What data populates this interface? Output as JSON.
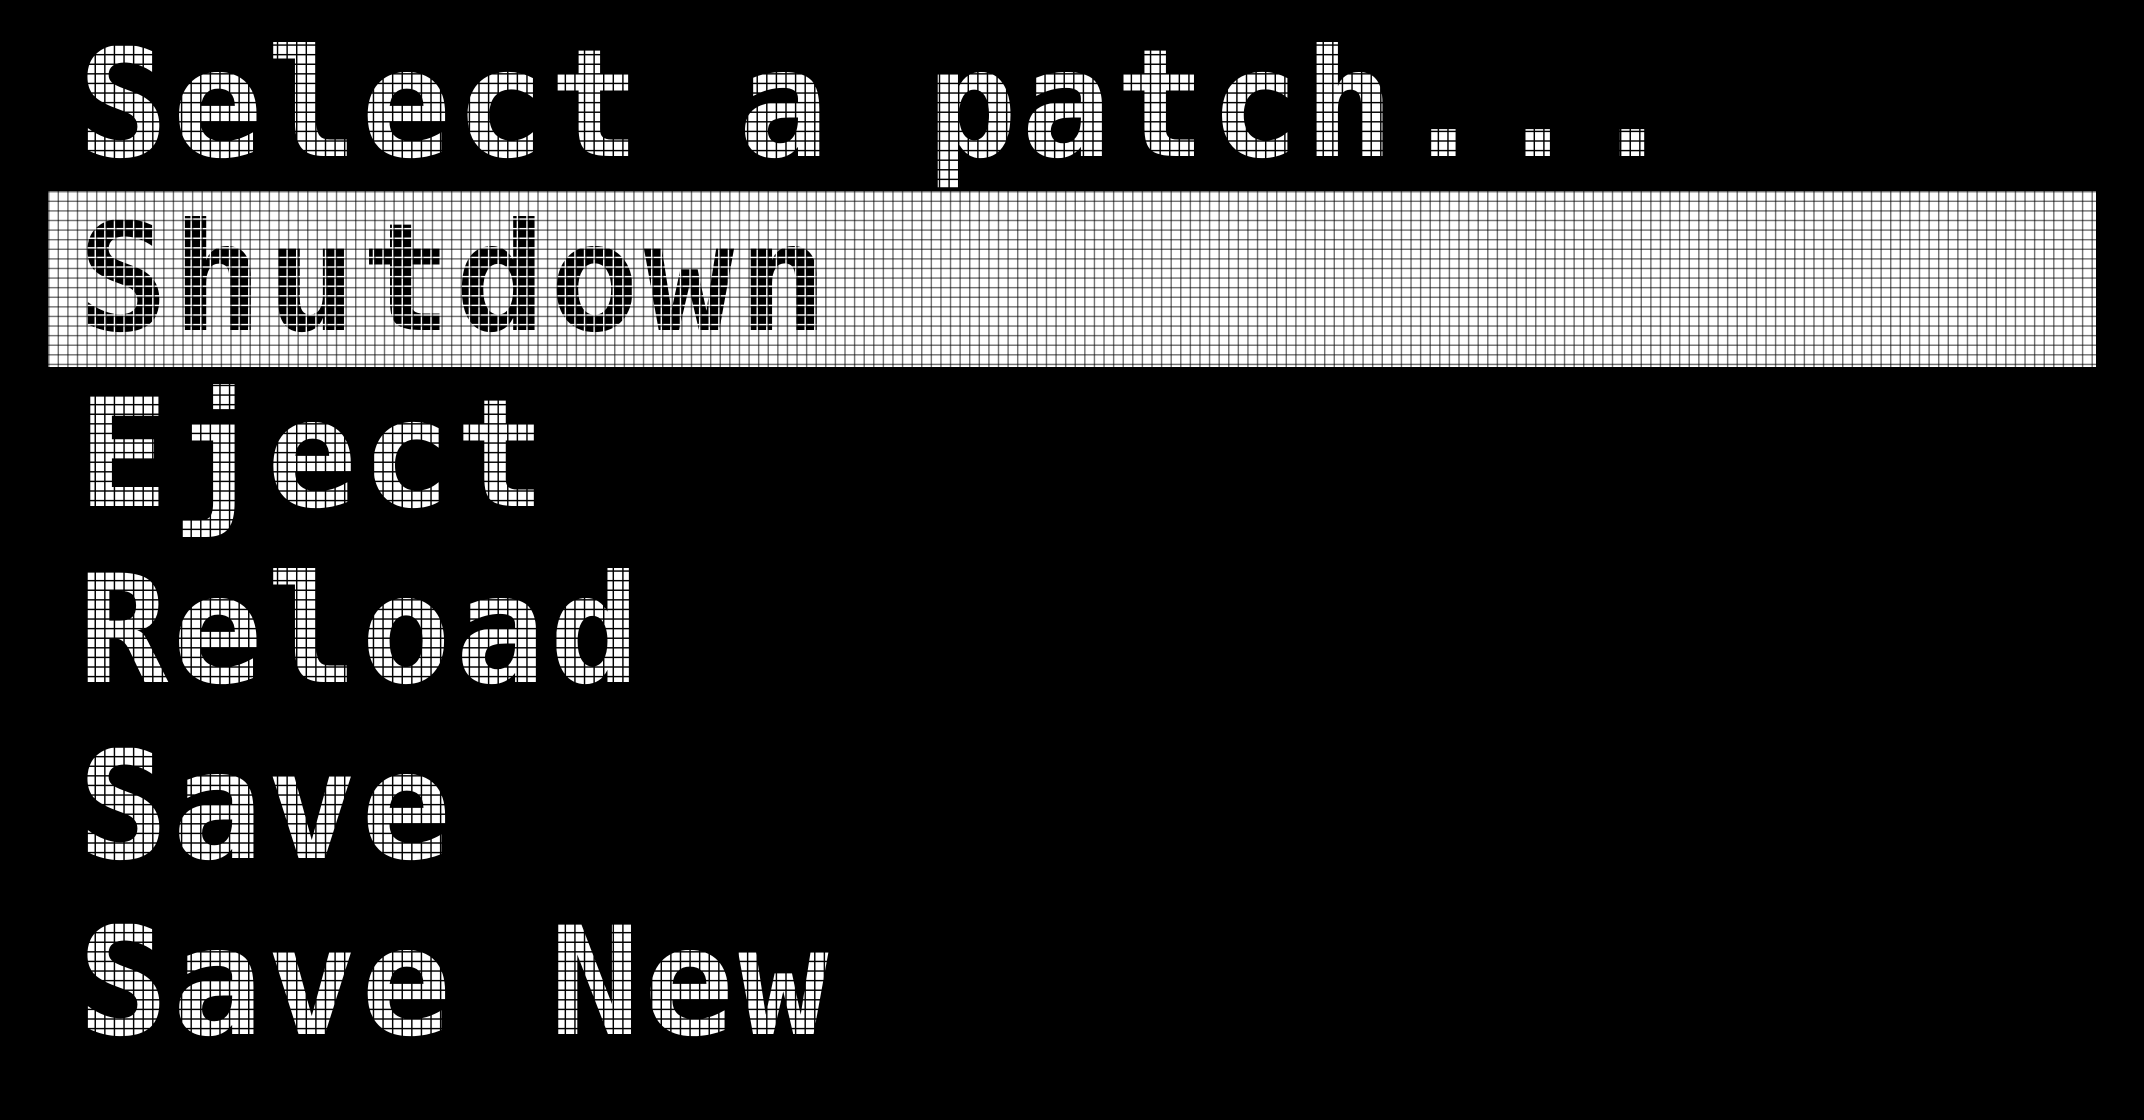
{
  "prompt": "Select a patch...",
  "menu": {
    "items": [
      {
        "label": "Shutdown",
        "selected": true
      },
      {
        "label": "Eject",
        "selected": false
      },
      {
        "label": "Reload",
        "selected": false
      },
      {
        "label": "Save",
        "selected": false
      },
      {
        "label": "Save New",
        "selected": false
      }
    ]
  },
  "colors": {
    "background": "#000000",
    "foreground": "#ffffff",
    "highlight": "#ffffff"
  }
}
